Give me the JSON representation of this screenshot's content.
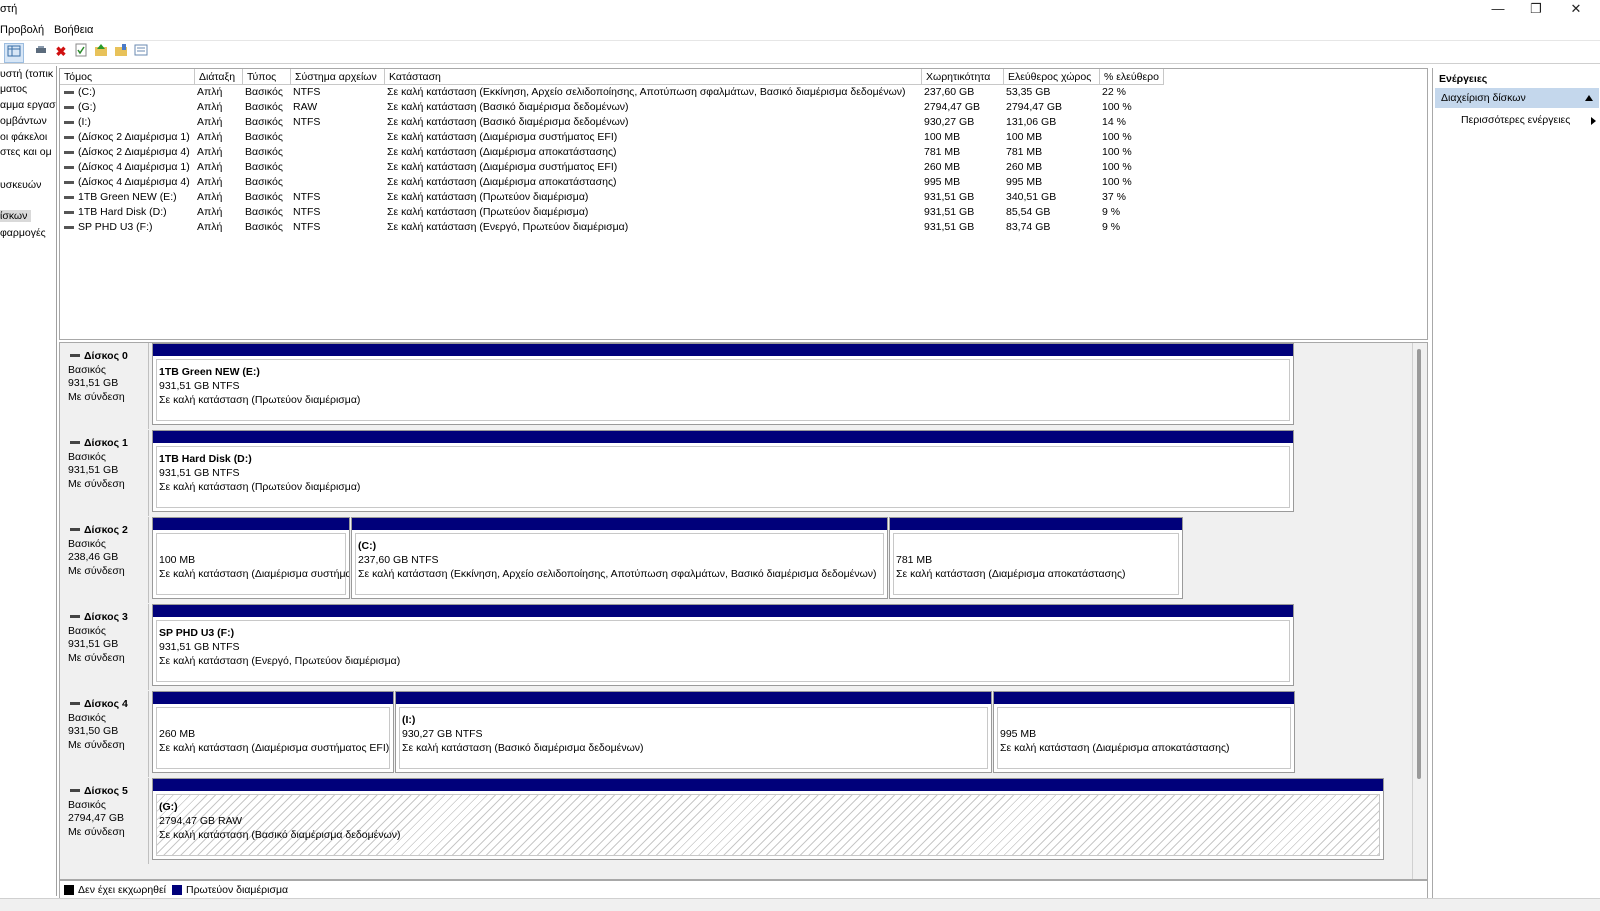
{
  "window": {
    "title": "στή",
    "controls": [
      "—",
      "❐",
      "✕"
    ]
  },
  "menu": {
    "items": [
      "Προβολή",
      "Βοήθεια"
    ]
  },
  "left_nav": {
    "items": [
      "υστή (τοπικ",
      "ματος",
      "αμμα εργασ",
      "ομβάντων",
      "οι φάκελοι",
      "στες και ομ",
      "",
      "υσκευών",
      "",
      "ίσκων",
      "φαρμογές"
    ]
  },
  "volume_list": {
    "columns": [
      "Τόμος",
      "Διάταξη",
      "Τύπος",
      "Σύστημα αρχείων",
      "Κατάσταση",
      "Χωρητικότητα",
      "Ελεύθερος χώρος",
      "% ελεύθερο"
    ],
    "rows": [
      [
        "(C:)",
        "Απλή",
        "Βασικός",
        "NTFS",
        "Σε καλή κατάσταση (Εκκίνηση, Αρχείο σελιδοποίησης, Αποτύπωση σφαλμάτων, Βασικό διαμέρισμα δεδομένων)",
        "237,60 GB",
        "53,35 GB",
        "22 %"
      ],
      [
        "(G:)",
        "Απλή",
        "Βασικός",
        "RAW",
        "Σε καλή κατάσταση (Βασικό διαμέρισμα δεδομένων)",
        "2794,47 GB",
        "2794,47 GB",
        "100 %"
      ],
      [
        "(I:)",
        "Απλή",
        "Βασικός",
        "NTFS",
        "Σε καλή κατάσταση (Βασικό διαμέρισμα δεδομένων)",
        "930,27 GB",
        "131,06 GB",
        "14 %"
      ],
      [
        "(Δίσκος 2 Διαμέρισμα 1)",
        "Απλή",
        "Βασικός",
        "",
        "Σε καλή κατάσταση (Διαμέρισμα συστήματος EFI)",
        "100 MB",
        "100 MB",
        "100 %"
      ],
      [
        "(Δίσκος 2 Διαμέρισμα 4)",
        "Απλή",
        "Βασικός",
        "",
        "Σε καλή κατάσταση (Διαμέρισμα αποκατάστασης)",
        "781 MB",
        "781 MB",
        "100 %"
      ],
      [
        "(Δίσκος 4 Διαμέρισμα 1)",
        "Απλή",
        "Βασικός",
        "",
        "Σε καλή κατάσταση (Διαμέρισμα συστήματος EFI)",
        "260 MB",
        "260 MB",
        "100 %"
      ],
      [
        "(Δίσκος 4 Διαμέρισμα 4)",
        "Απλή",
        "Βασικός",
        "",
        "Σε καλή κατάσταση (Διαμέρισμα αποκατάστασης)",
        "995 MB",
        "995 MB",
        "100 %"
      ],
      [
        "1TB Green NEW (E:)",
        "Απλή",
        "Βασικός",
        "NTFS",
        "Σε καλή κατάσταση (Πρωτεύον διαμέρισμα)",
        "931,51 GB",
        "340,51 GB",
        "37 %"
      ],
      [
        "1TB Hard Disk (D:)",
        "Απλή",
        "Βασικός",
        "NTFS",
        "Σε καλή κατάσταση (Πρωτεύον διαμέρισμα)",
        "931,51 GB",
        "85,54 GB",
        "9 %"
      ],
      [
        "SP PHD U3 (F:)",
        "Απλή",
        "Βασικός",
        "NTFS",
        "Σε καλή κατάσταση (Ενεργό, Πρωτεύον διαμέρισμα)",
        "931,51 GB",
        "83,74 GB",
        "9 %"
      ]
    ]
  },
  "disks": [
    {
      "name": "Δίσκος 0",
      "type": "Βασικός",
      "size": "931,51 GB",
      "status": "Με σύνδεση",
      "partitions": [
        {
          "name": "1TB Green NEW  (E:)",
          "size": "931,51 GB NTFS",
          "status": "Σε καλή κατάσταση (Πρωτεύον διαμέρισμα)",
          "raw": false
        }
      ]
    },
    {
      "name": "Δίσκος 1",
      "type": "Βασικός",
      "size": "931,51 GB",
      "status": "Με σύνδεση",
      "partitions": [
        {
          "name": "1TB Hard Disk  (D:)",
          "size": "931,51 GB NTFS",
          "status": "Σε καλή κατάσταση (Πρωτεύον διαμέρισμα)",
          "raw": false
        }
      ]
    },
    {
      "name": "Δίσκος 2",
      "type": "Βασικός",
      "size": "238,46 GB",
      "status": "Με σύνδεση",
      "partitions": [
        {
          "name": "",
          "size": "100 MB",
          "status": "Σε καλή κατάσταση (Διαμέρισμα συστήματος EFI)",
          "raw": false
        },
        {
          "name": "(C:)",
          "size": "237,60 GB NTFS",
          "status": "Σε καλή κατάσταση (Εκκίνηση, Αρχείο σελιδοποίησης, Αποτύπωση σφαλμάτων, Βασικό διαμέρισμα δεδομένων)",
          "raw": false
        },
        {
          "name": "",
          "size": "781 MB",
          "status": "Σε καλή κατάσταση (Διαμέρισμα αποκατάστασης)",
          "raw": false
        }
      ]
    },
    {
      "name": "Δίσκος 3",
      "type": "Βασικός",
      "size": "931,51 GB",
      "status": "Με σύνδεση",
      "partitions": [
        {
          "name": "SP PHD U3  (F:)",
          "size": "931,51 GB NTFS",
          "status": "Σε καλή κατάσταση (Ενεργό, Πρωτεύον διαμέρισμα)",
          "raw": false
        }
      ]
    },
    {
      "name": "Δίσκος 4",
      "type": "Βασικός",
      "size": "931,50 GB",
      "status": "Με σύνδεση",
      "partitions": [
        {
          "name": "",
          "size": "260 MB",
          "status": "Σε καλή κατάσταση (Διαμέρισμα συστήματος EFI)",
          "raw": false
        },
        {
          "name": "(I:)",
          "size": "930,27 GB NTFS",
          "status": "Σε καλή κατάσταση (Βασικό διαμέρισμα δεδομένων)",
          "raw": false
        },
        {
          "name": "",
          "size": "995 MB",
          "status": "Σε καλή κατάσταση (Διαμέρισμα αποκατάστασης)",
          "raw": false
        }
      ]
    },
    {
      "name": "Δίσκος 5",
      "type": "Βασικός",
      "size": "2794,47 GB",
      "status": "Με σύνδεση",
      "partitions": [
        {
          "name": "(G:)",
          "size": "2794,47 GB RAW",
          "status": "Σε καλή κατάσταση (Βασικό διαμέρισμα δεδομένων)",
          "raw": true
        }
      ]
    }
  ],
  "legend": [
    {
      "label": "Δεν έχει εκχωρηθεί",
      "color": "#000000"
    },
    {
      "label": "Πρωτεύον διαμέρισμα",
      "color": "#00007a"
    }
  ],
  "actions": {
    "header": "Ενέργειες",
    "selected": "Διαχείριση δίσκων",
    "more": "Περισσότερες ενέργειες"
  },
  "toolbar_icons": [
    "console-tree-icon",
    "properties-icon",
    "delete-icon",
    "check-icon",
    "up-folder-icon",
    "open-folder-icon",
    "list-icon"
  ]
}
